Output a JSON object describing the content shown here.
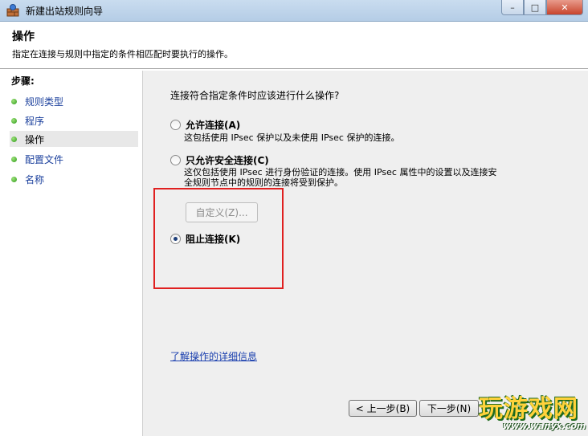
{
  "window": {
    "title": "新建出站规则向导",
    "min_glyph": "–",
    "max_glyph": "□",
    "close_glyph": "✕"
  },
  "header": {
    "title": "操作",
    "description": "指定在连接与规则中指定的条件相匹配时要执行的操作。"
  },
  "sidebar": {
    "title": "步骤:",
    "items": [
      {
        "label": "规则类型",
        "active": false
      },
      {
        "label": "程序",
        "active": false
      },
      {
        "label": "操作",
        "active": true
      },
      {
        "label": "配置文件",
        "active": false
      },
      {
        "label": "名称",
        "active": false
      }
    ]
  },
  "main": {
    "question": "连接符合指定条件时应该进行什么操作?",
    "options": [
      {
        "label": "允许连接(A)",
        "checked": false,
        "description_lines": [
          "这包括使用 IPsec 保护以及未使用 IPsec 保护的连接。"
        ]
      },
      {
        "label": "只允许安全连接(C)",
        "checked": false,
        "description_lines": [
          "这仅包括使用 IPsec 进行身份验证的连接。使用 IPsec 属性中的设置以及连接安",
          "全规则节点中的规则的连接将受到保护。"
        ]
      },
      {
        "label": "阻止连接(K)",
        "checked": true,
        "description_lines": []
      }
    ],
    "customize_button": "自定义(Z)...",
    "learn_more_link": "了解操作的详细信息"
  },
  "buttons": {
    "back": "< 上一步(B)",
    "next": "下一步(N)"
  },
  "watermark": {
    "text": "玩游戏网",
    "url": "www.wanyx.com"
  }
}
